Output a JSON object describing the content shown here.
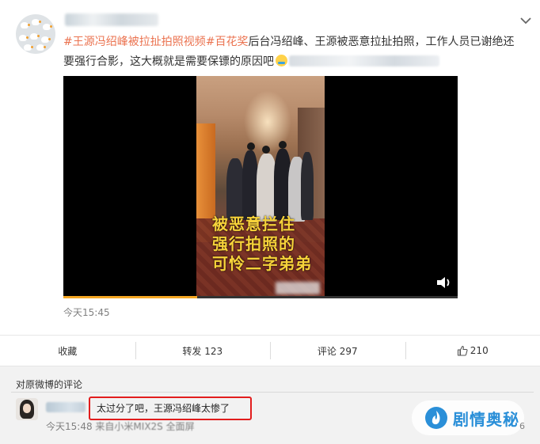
{
  "post": {
    "topic_tag": "#王源冯绍峰被拉扯拍照视频#",
    "topic_tag_2": "百花奖",
    "text_after_tags": "后台冯绍峰、王源被恶意拉扯拍照，工作人员已谢绝还要强行合影，这大概就是需要保镖的原因吧",
    "time": "今天15:45"
  },
  "video": {
    "overlay_lines": [
      "被恶意拦住",
      "强行拍照的",
      "可怜二字弟弟"
    ],
    "progress": 0.34,
    "icon": "volume-icon"
  },
  "actions": {
    "collect": "收藏",
    "repost": "转发 123",
    "comment": "评论 297",
    "like_count": "210",
    "like_icon": "thumbs-up-icon"
  },
  "comment_section": {
    "title": "对原微博的评论",
    "comment_text": "太过分了吧，王源冯绍峰太惨了",
    "meta_time": "今天15:48",
    "meta_source": "来自小米MIX2S 全面屏",
    "highlight_color": "#e21d1d"
  },
  "watermark": {
    "text": "剧情奥秘",
    "tail": "6"
  },
  "colors": {
    "topic": "#eb7350",
    "badge": "#2a8fd8"
  }
}
